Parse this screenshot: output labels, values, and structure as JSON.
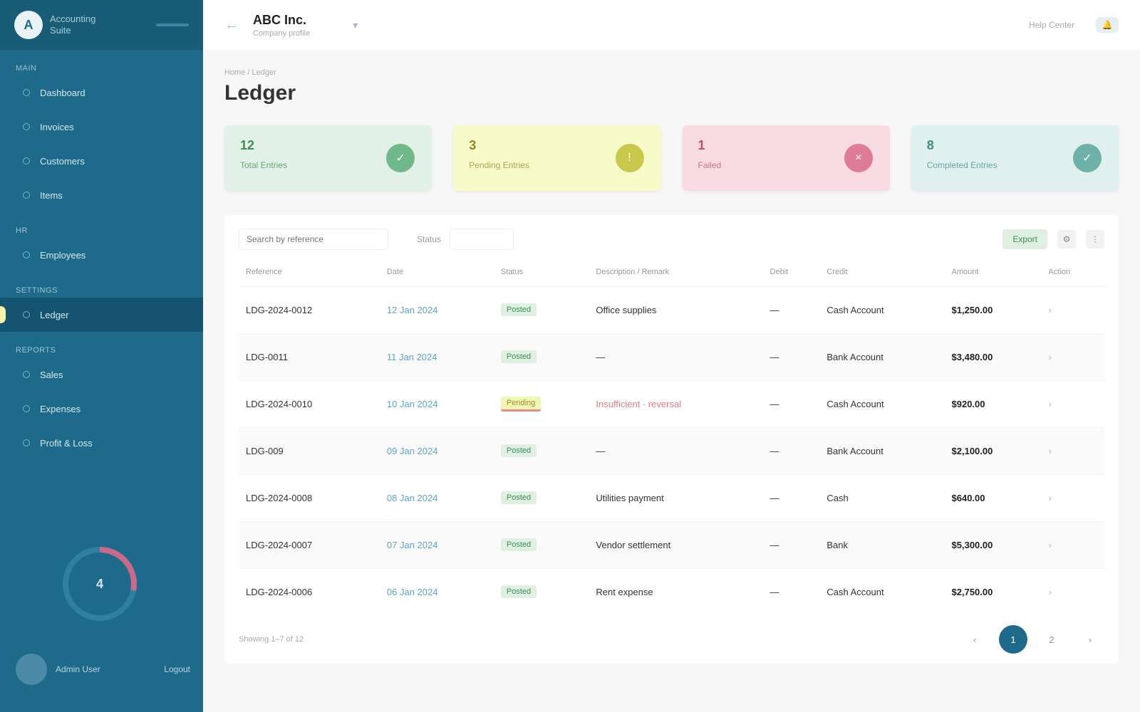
{
  "brand": {
    "logo": "A",
    "name": "Accounting",
    "tagline": "Suite"
  },
  "sidebar": {
    "sections": [
      {
        "label": "MAIN",
        "items": [
          {
            "label": "Dashboard"
          },
          {
            "label": "Invoices"
          },
          {
            "label": "Customers"
          },
          {
            "label": "Items"
          }
        ]
      },
      {
        "label": "HR",
        "items": [
          {
            "label": "Employees"
          }
        ]
      },
      {
        "label": "SETTINGS",
        "items": [
          {
            "label": "Ledger"
          }
        ]
      },
      {
        "label": "REPORTS",
        "items": [
          {
            "label": "Sales"
          },
          {
            "label": "Expenses"
          },
          {
            "label": "Profit & Loss"
          }
        ]
      }
    ],
    "active": "Ledger",
    "donut_value": "4",
    "donut_fraction": 0.28,
    "user": {
      "name": "Admin User",
      "logout": "Logout"
    }
  },
  "topbar": {
    "back": "←",
    "company": "ABC Inc.",
    "company_sub": "Company profile",
    "dropdown": "▾",
    "help": "Help Center",
    "bell": "🔔"
  },
  "page": {
    "breadcrumb": "Home / Ledger",
    "title": "Ledger"
  },
  "stats": [
    {
      "value": "12",
      "label": "Total Entries",
      "bg": "#e2f1e7",
      "fg": "#3d8f54",
      "ic_bg": "#6fb98a",
      "icon": "✓"
    },
    {
      "value": "3",
      "label": "Pending Entries",
      "bg": "#f6fbc8",
      "fg": "#8f8a22",
      "ic_bg": "#c8c94a",
      "icon": "!"
    },
    {
      "value": "1",
      "label": "Failed",
      "bg": "#f9dbe3",
      "fg": "#c0506a",
      "ic_bg": "#e07b95",
      "icon": "×"
    },
    {
      "value": "8",
      "label": "Completed Entries",
      "bg": "#e0f0ee",
      "fg": "#3d8f88",
      "ic_bg": "#6db2a8",
      "icon": "✓"
    }
  ],
  "toolbar": {
    "search_placeholder": "Search by reference",
    "filter_label": "Status",
    "export_label": "Export",
    "icon1": "⚙",
    "icon2": "⋮"
  },
  "table": {
    "headers": [
      "Reference",
      "Date",
      "Status",
      "Description / Remark",
      "Debit",
      "Credit",
      "Amount",
      "Action"
    ],
    "rows": [
      [
        "LDG-2024-0012",
        "12 Jan 2024",
        "Posted",
        "Office supplies",
        "—",
        "Cash Account",
        "$1,250.00",
        "›"
      ],
      [
        "LDG-0011",
        "11 Jan 2024",
        "Posted",
        "—",
        "—",
        "Bank Account",
        "$3,480.00",
        "›"
      ],
      [
        "LDG-2024-0010",
        "10 Jan 2024",
        "Pending",
        "Insufficient · reversal",
        "—",
        "Cash Account",
        "$920.00",
        "›"
      ],
      [
        "LDG-009",
        "09 Jan 2024",
        "Posted",
        "—",
        "—",
        "Bank Account",
        "$2,100.00",
        "›"
      ],
      [
        "LDG-2024-0008",
        "08 Jan 2024",
        "Posted",
        "Utilities payment",
        "—",
        "Cash",
        "$640.00",
        "›"
      ],
      [
        "LDG-2024-0007",
        "07 Jan 2024",
        "Posted",
        "Vendor settlement",
        "—",
        "Bank",
        "$5,300.00",
        "›"
      ],
      [
        "LDG-2024-0006",
        "06 Jan 2024",
        "Posted",
        "Rent expense",
        "—",
        "Cash Account",
        "$2,750.00",
        "›"
      ]
    ]
  },
  "pager": {
    "info": "Showing 1–7 of 12",
    "prev": "‹",
    "current": "1",
    "page2": "2",
    "next": "›"
  }
}
